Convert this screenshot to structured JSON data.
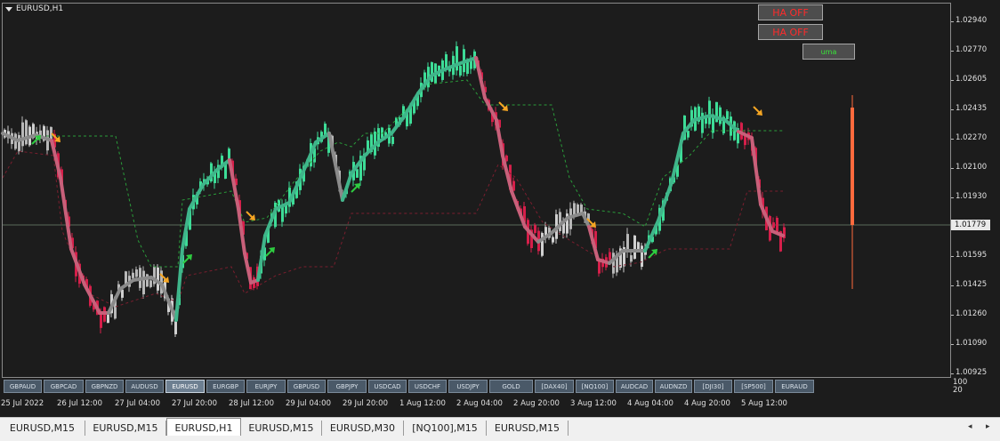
{
  "chart": {
    "title": "EURUSD,H1",
    "current_price": "1.01779"
  },
  "buttons": {
    "ha_off_1": "HA OFF",
    "ha_off_2": "HA OFF",
    "uma": "uma"
  },
  "price_scale": {
    "ticks": [
      "1.02940",
      "1.02770",
      "1.02605",
      "1.02435",
      "1.02270",
      "1.02100",
      "1.01930",
      "1.01595",
      "1.01425",
      "1.01260",
      "1.01090",
      "1.00925"
    ]
  },
  "mini_scale": [
    "100",
    "20"
  ],
  "symbols": [
    "GBPAUD",
    "GBPCAD",
    "GBPNZD",
    "AUDUSD",
    "EURUSD",
    "EURGBP",
    "EURJPY",
    "GBPUSD",
    "GBPJPY",
    "USDCAD",
    "USDCHF",
    "USDJPY",
    "GOLD",
    "[DAX40]",
    "[NQ100]",
    "AUDCAD",
    "AUDNZD",
    "[DJI30]",
    "[SP500]",
    "EURAUD"
  ],
  "active_symbol": "EURUSD",
  "time_axis": [
    "25 Jul 2022",
    "26 Jul 12:00",
    "27 Jul 04:00",
    "27 Jul 20:00",
    "28 Jul 12:00",
    "29 Jul 04:00",
    "29 Jul 20:00",
    "1 Aug 12:00",
    "2 Aug 04:00",
    "2 Aug 20:00",
    "3 Aug 12:00",
    "4 Aug 04:00",
    "4 Aug 20:00",
    "5 Aug 12:00"
  ],
  "tabs": [
    "EURUSD,M15",
    "EURUSD,M15",
    "EURUSD,H1",
    "EURUSD,M15",
    "EURUSD,M30",
    "[NQ100],M15",
    "EURUSD,M15"
  ],
  "active_tab_index": 2,
  "nav": {
    "left": "◂",
    "right": "▸"
  },
  "colors": {
    "bull": "#3ddc97",
    "bear": "#d61f4a",
    "neutral": "#d0d0d0",
    "ma_gray": "#8a8a8a",
    "ma_green": "#3fb58a",
    "ma_pink": "#c8607a",
    "arrow_up": "#2ecc40",
    "arrow_down": "#f5a623",
    "signal_bar": "#ff6a3d"
  }
}
